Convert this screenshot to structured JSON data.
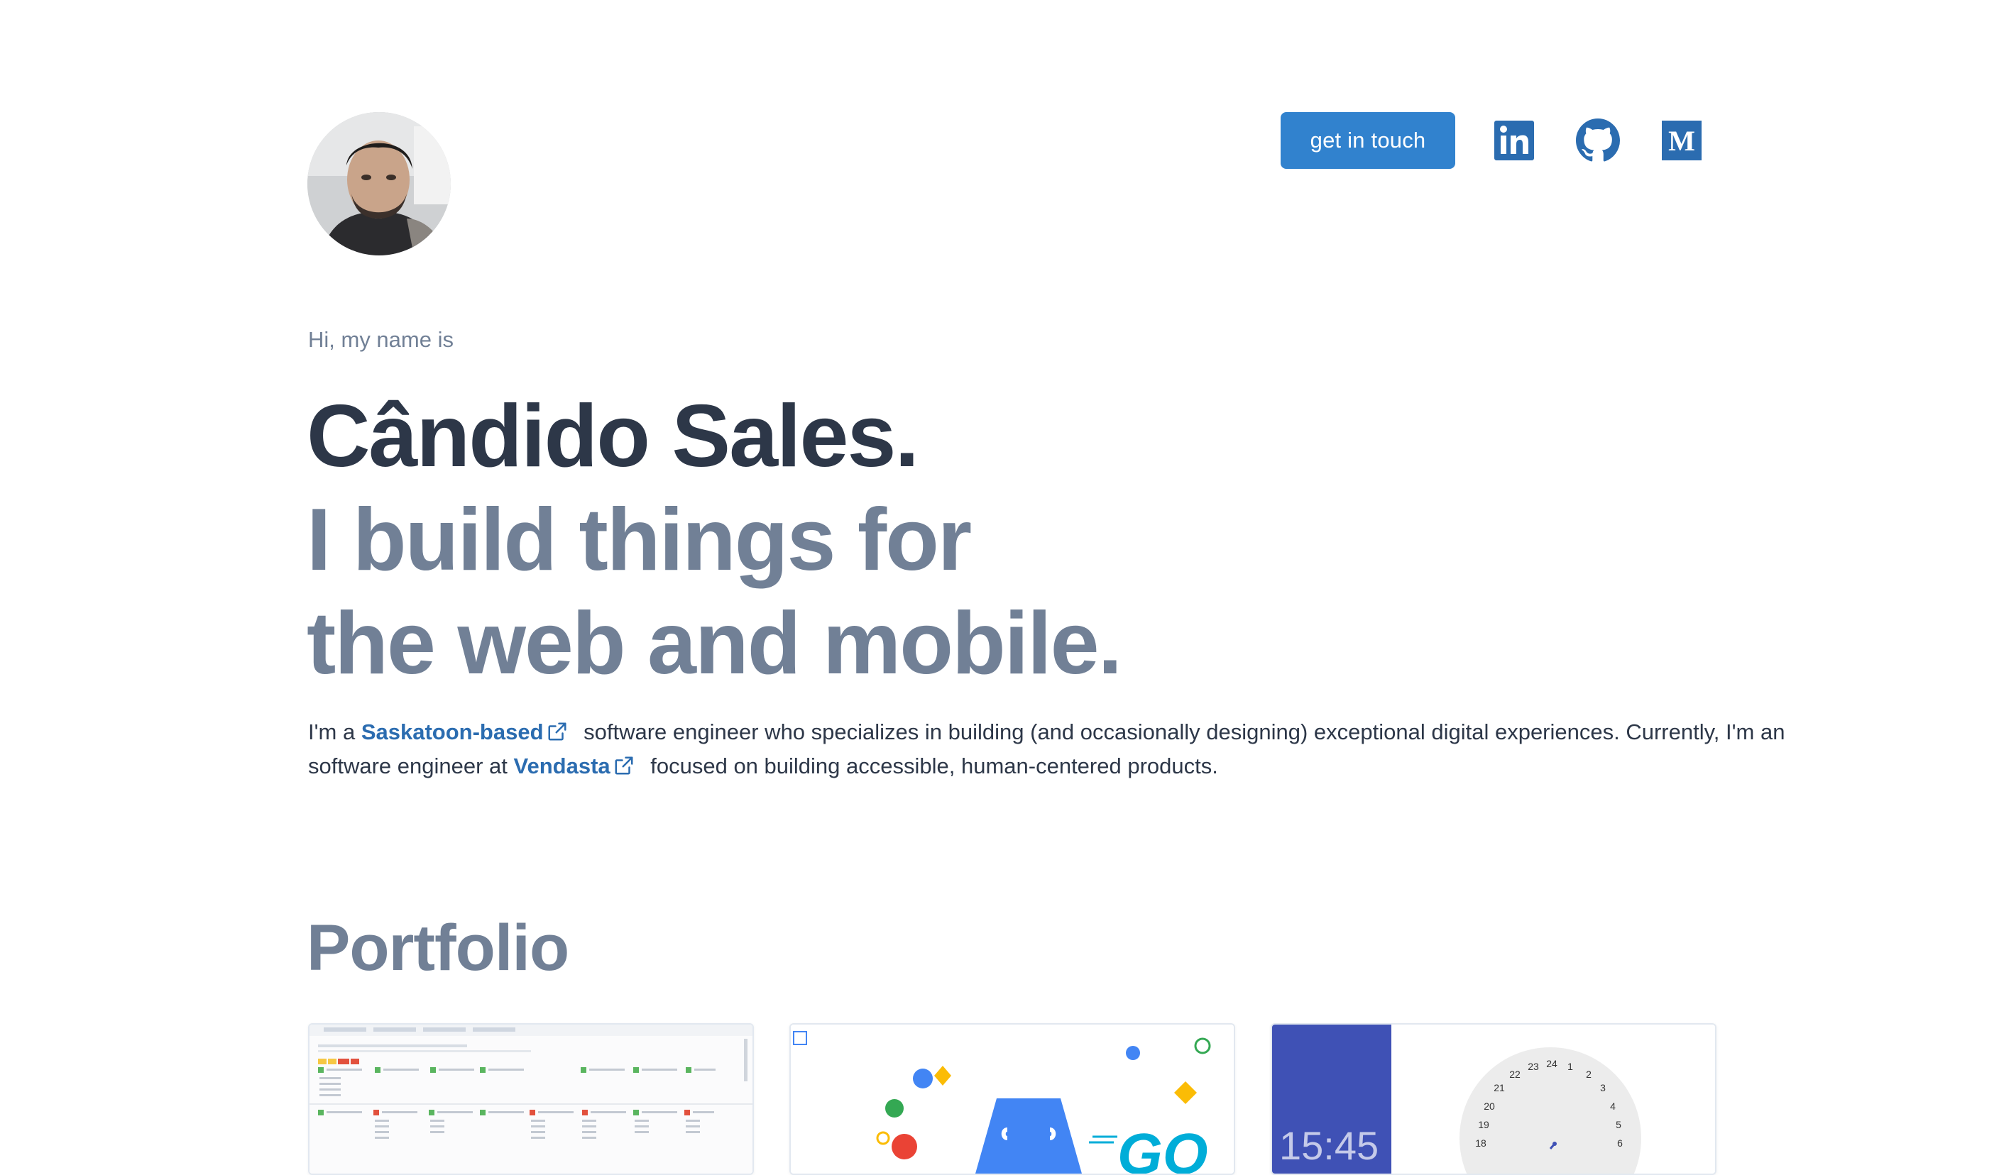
{
  "header": {
    "avatar_alt": "",
    "cta_label": "get in touch",
    "social": [
      {
        "name": "linkedin-icon"
      },
      {
        "name": "github-icon"
      },
      {
        "name": "medium-icon"
      }
    ]
  },
  "hero": {
    "greeting": "Hi, my name is",
    "name": "Cândido Sales.",
    "tagline_line1": "I build things for",
    "tagline_line2": "the web and mobile."
  },
  "bio": {
    "part1": "I'm a ",
    "link1": "Saskatoon-based",
    "part2": " software engineer who specializes in building (and occasionally designing) exceptional digital experiences. Currently, I'm an software engineer at ",
    "link2": "Vendasta",
    "part3": " focused on building accessible, human-centered products."
  },
  "portfolio": {
    "title": "Portfolio",
    "cards": [
      {
        "preview": "spreadsheet-preview"
      },
      {
        "preview": "cloud-functions-go-preview"
      },
      {
        "preview": "clock-app-preview"
      }
    ],
    "clock_time": "15:45",
    "clock_numbers": [
      "22",
      "23",
      "24",
      "1",
      "2",
      "21",
      "3",
      "20",
      "4",
      "19",
      "5",
      "18",
      "6"
    ]
  },
  "colors": {
    "accent": "#3182ce",
    "link": "#2b6cb0",
    "heading": "#2d3748",
    "muted": "#718096"
  }
}
